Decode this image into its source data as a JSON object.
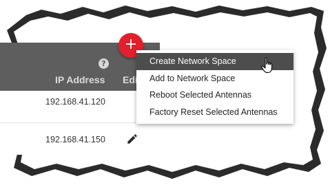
{
  "table": {
    "columns": {
      "ip_address": "IP Address",
      "edit": "Edit"
    },
    "help_icon": "?",
    "rows": [
      {
        "ip": "192.168.41.120",
        "editable": false
      },
      {
        "ip": "192.168.41.150",
        "editable": true
      }
    ]
  },
  "fab": {
    "symbol": "+",
    "color": "#e2202c"
  },
  "menu": {
    "items": [
      {
        "label": "Create Network Space",
        "active": true
      },
      {
        "label": "Add to Network Space",
        "active": false
      },
      {
        "label": "Reboot Selected Antennas",
        "active": false
      },
      {
        "label": "Factory Reset Selected Antennas",
        "active": false
      }
    ]
  },
  "icons": {
    "edit": "pencil-icon",
    "help": "question-circle-icon",
    "cursor": "hand-pointer-icon"
  },
  "colors": {
    "header_bg": "#5e5e5e",
    "menu_active_bg": "#4d4d4d",
    "accent": "#e2202c"
  }
}
